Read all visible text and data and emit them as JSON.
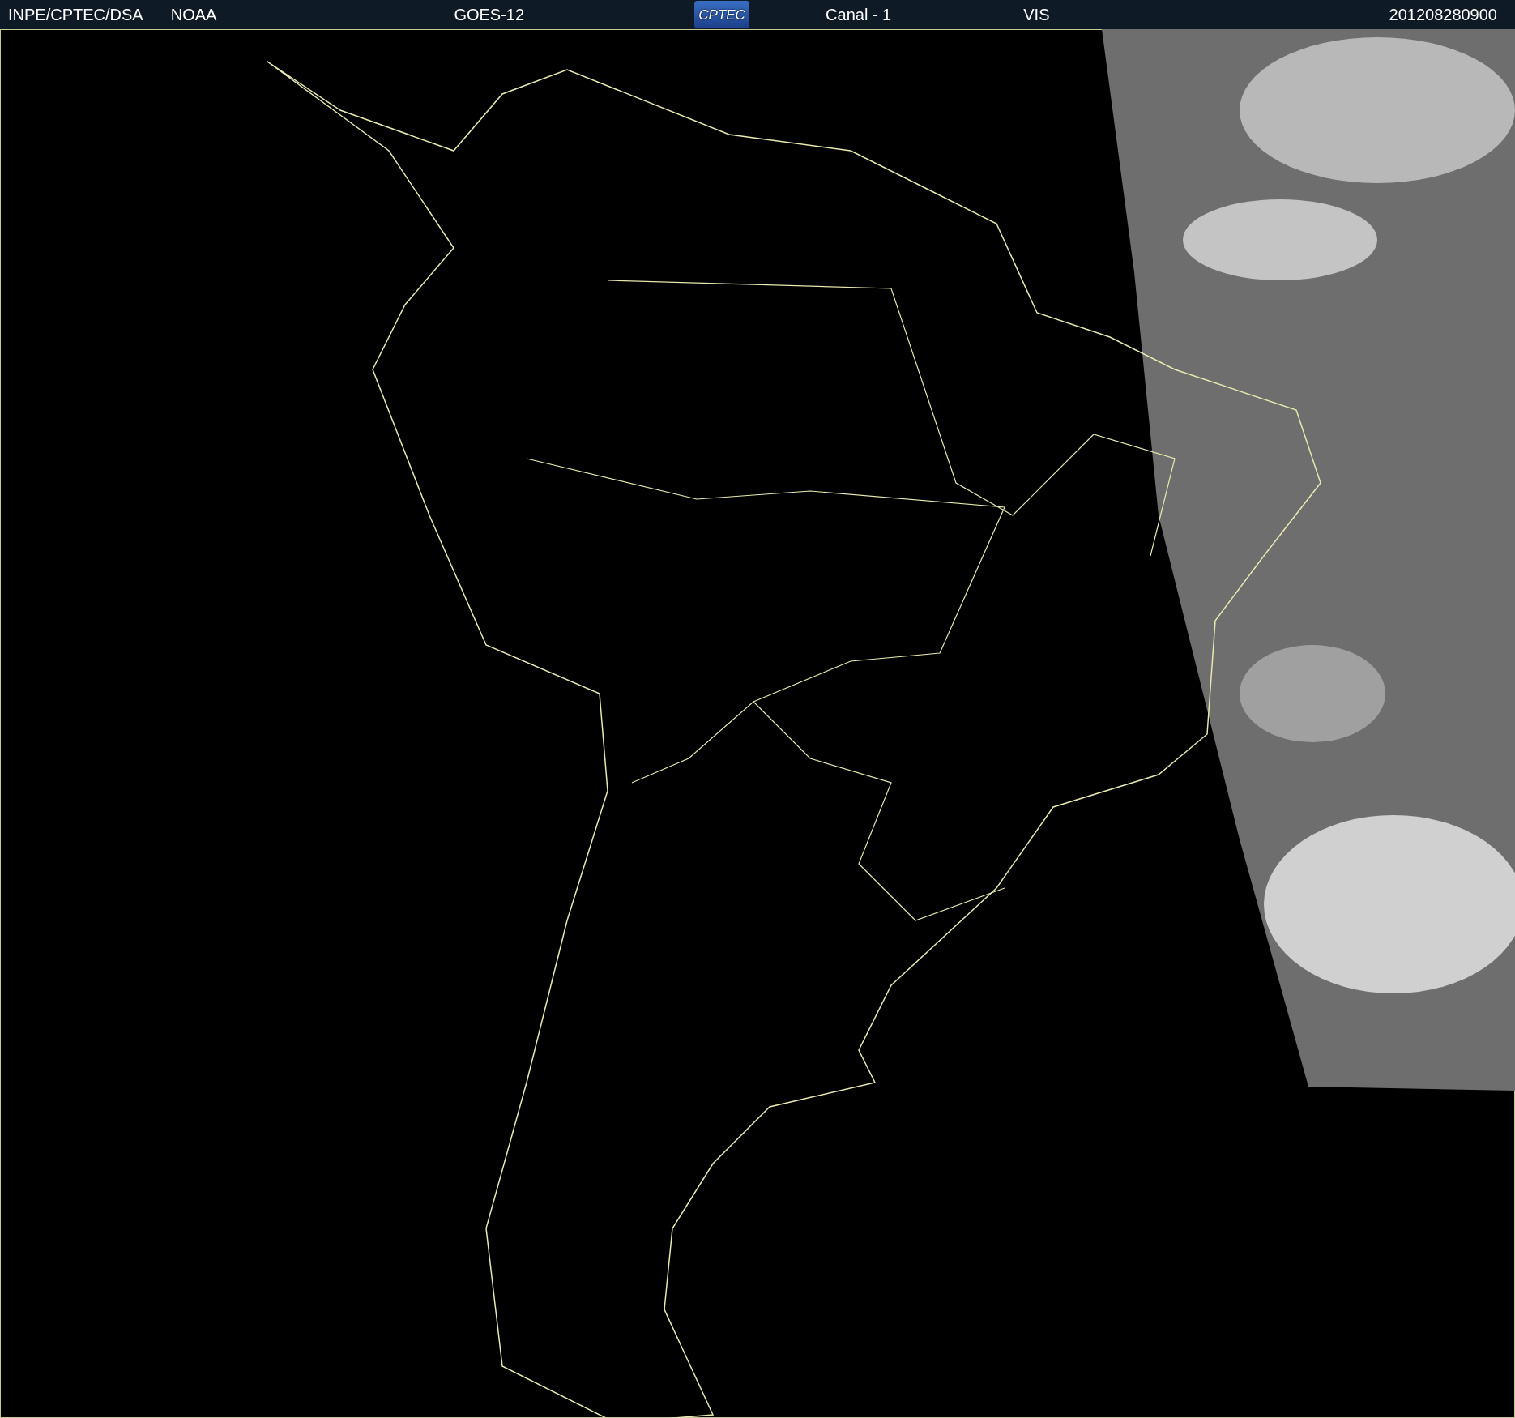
{
  "header": {
    "source": "INPE/CPTEC/DSA",
    "agency": "NOAA",
    "satellite": "GOES-12",
    "logo": "CPTEC",
    "channel": "Canal - 1",
    "band": "VIS",
    "timestamp": "201208280900"
  }
}
